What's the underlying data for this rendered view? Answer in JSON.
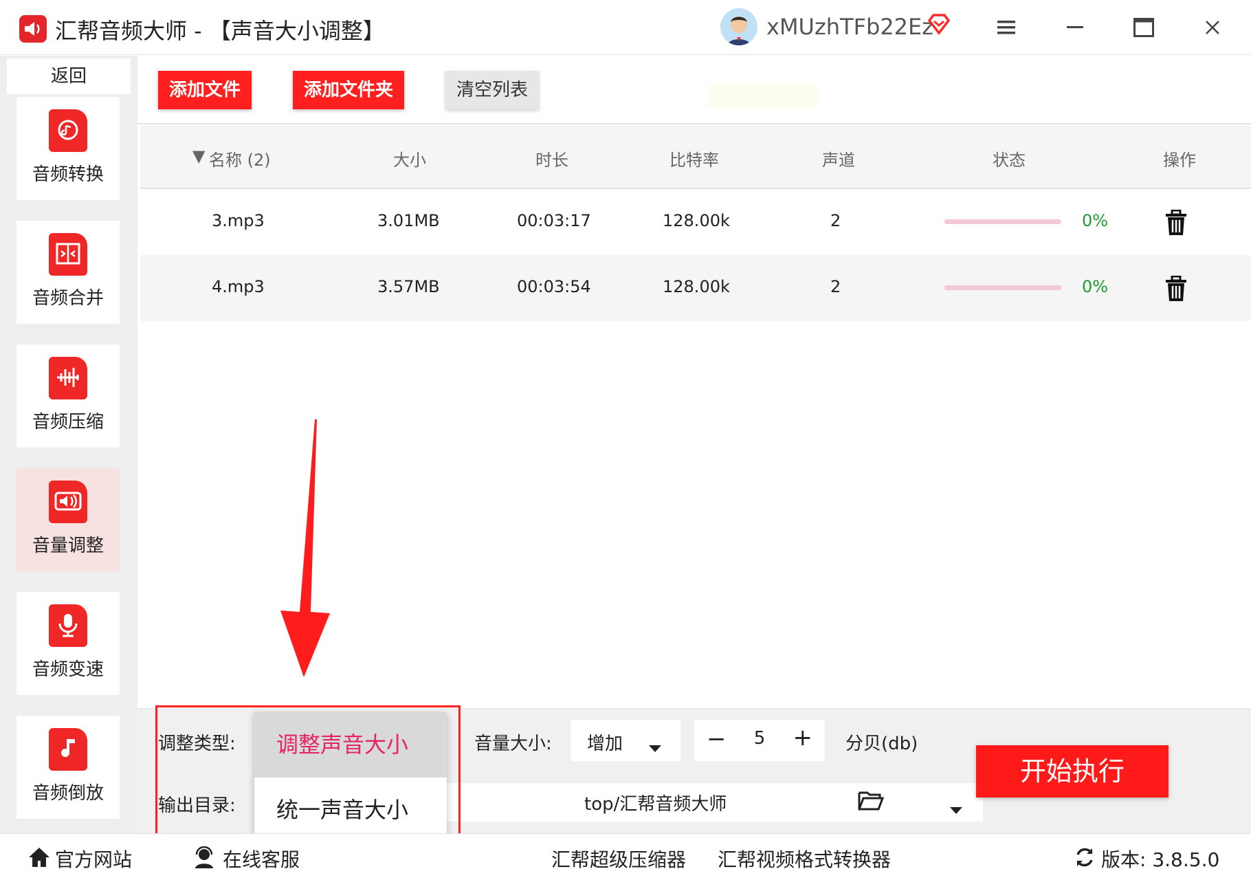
{
  "window": {
    "title": "汇帮音频大师 - 【声音大小调整】",
    "username": "xMUzhTFb22Ez"
  },
  "sidebar": {
    "back_label": "返回",
    "items": [
      {
        "label": "音频转换",
        "icon": "audio-convert-icon"
      },
      {
        "label": "音频合并",
        "icon": "audio-merge-icon"
      },
      {
        "label": "音频压缩",
        "icon": "audio-compress-icon"
      },
      {
        "label": "音量调整",
        "icon": "volume-adjust-icon",
        "active": true
      },
      {
        "label": "音频变速",
        "icon": "audio-speed-icon"
      },
      {
        "label": "音频倒放",
        "icon": "audio-reverse-icon"
      }
    ]
  },
  "toolbar": {
    "add_file": "添加文件",
    "add_folder": "添加文件夹",
    "clear_list": "清空列表"
  },
  "table": {
    "headers": {
      "name": "名称 (2)",
      "size": "大小",
      "duration": "时长",
      "bitrate": "比特率",
      "channels": "声道",
      "status": "状态",
      "action": "操作"
    },
    "rows": [
      {
        "name": "3.mp3",
        "size": "3.01MB",
        "duration": "00:03:17",
        "bitrate": "128.00k",
        "channels": "2",
        "progress": "0%"
      },
      {
        "name": "4.mp3",
        "size": "3.57MB",
        "duration": "00:03:54",
        "bitrate": "128.00k",
        "channels": "2",
        "progress": "0%"
      }
    ]
  },
  "settings": {
    "adjust_type_label": "调整类型:",
    "output_dir_label": "输出目录:",
    "volume_label": "音量大小:",
    "volume_mode": "增加",
    "volume_value": "5",
    "unit": "分贝(db)",
    "output_path": "top/汇帮音频大师",
    "start_button": "开始执行",
    "dropdown_options": [
      "调整声音大小",
      "统一声音大小"
    ]
  },
  "footer": {
    "website": "官方网站",
    "support": "在线客服",
    "compressor": "汇帮超级压缩器",
    "video_converter": "汇帮视频格式转换器",
    "version": "版本: 3.8.5.0"
  },
  "colors": {
    "accent_red": "#ff1f1f",
    "selected_pink": "#e32565",
    "progress_green": "#1a9b2f"
  }
}
